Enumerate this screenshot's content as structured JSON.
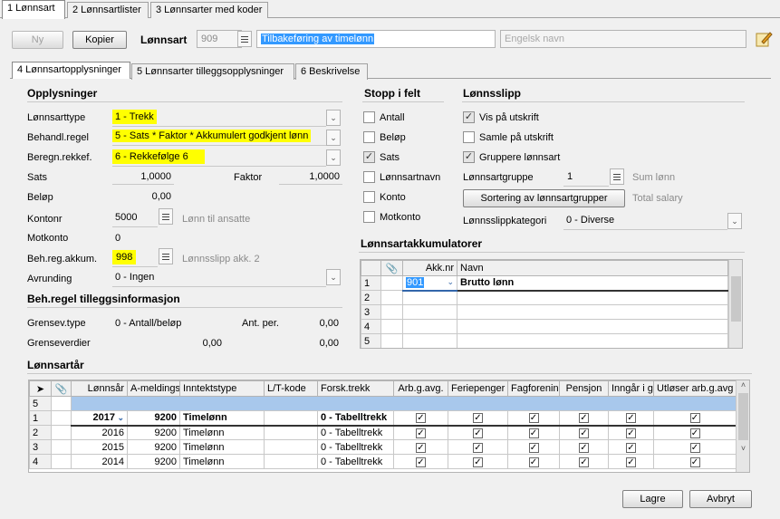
{
  "top_tabs": [
    "1 Lønnsart",
    "2 Lønnsartlister",
    "3 Lønnsarter med koder"
  ],
  "toolbar": {
    "new_label": "Ny",
    "copy_label": "Kopier",
    "lonnsart_label": "Lønnsart",
    "lonnsart_number": "909",
    "lonnsart_name": "Tilbakeføring av timelønn",
    "english_placeholder": "Engelsk navn"
  },
  "sub_tabs": [
    "4 Lønnsartopplysninger",
    "5 Lønnsarter tilleggsopplysninger",
    "6 Beskrivelse"
  ],
  "opplysninger": {
    "title": "Opplysninger",
    "lonnsarttype_label": "Lønnsarttype",
    "lonnsarttype_value": "1 - Trekk",
    "behandl_label": "Behandl.regel",
    "behandl_value": "5 - Sats * Faktor * Akkumulert godkjent lønn",
    "beregn_label": "Beregn.rekkef.",
    "beregn_value": "6 - Rekkefølge 6",
    "sats_label": "Sats",
    "sats_value": "1,0000",
    "faktor_label": "Faktor",
    "faktor_value": "1,0000",
    "belop_label": "Beløp",
    "belop_value": "0,00",
    "kontonr_label": "Kontonr",
    "kontonr_value": "5000",
    "kontonr_desc": "Lønn til ansatte",
    "motkonto_label": "Motkonto",
    "motkonto_value": "0",
    "behreg_label": "Beh.reg.akkum.",
    "behreg_value": "998",
    "behreg_desc": "Lønnsslipp akk. 2",
    "avrunding_label": "Avrunding",
    "avrunding_value": "0 - Ingen"
  },
  "tillegg": {
    "title": "Beh.regel tilleggsinformasjon",
    "grensev_type_label": "Grensev.type",
    "grensev_type_value": "0 - Antall/beløp",
    "ant_per_label": "Ant. per.",
    "ant_per_value": "0,00",
    "grenseverdier_label": "Grenseverdier",
    "grenseverdier_value1": "0,00",
    "grenseverdier_value2": "0,00"
  },
  "stopp": {
    "title": "Stopp i felt",
    "items": [
      {
        "label": "Antall",
        "checked": false
      },
      {
        "label": "Beløp",
        "checked": false
      },
      {
        "label": "Sats",
        "checked": true
      },
      {
        "label": "Lønnsartnavn",
        "checked": false
      },
      {
        "label": "Konto",
        "checked": false
      },
      {
        "label": "Motkonto",
        "checked": false
      }
    ]
  },
  "lonnsslipp": {
    "title": "Lønnsslipp",
    "vis": "Vis på utskrift",
    "samle": "Samle på utskrift",
    "gruppere": "Gruppere lønnsart",
    "gruppe_label": "Lønnsartgruppe",
    "gruppe_value": "1",
    "gruppe_desc": "Sum lønn",
    "sortering_button": "Sortering av lønnsartgrupper",
    "sortering_desc": "Total salary",
    "kategori_label": "Lønnsslippkategori",
    "kategori_value": "0 - Diverse"
  },
  "akkumulatorer": {
    "title": "Lønnsartakkumulatorer",
    "columns": [
      "Akk.nr",
      "Navn"
    ],
    "rows": [
      {
        "num": "1",
        "akknr": "901",
        "navn": "Brutto lønn"
      },
      {
        "num": "2",
        "akknr": "",
        "navn": ""
      },
      {
        "num": "3",
        "akknr": "",
        "navn": ""
      },
      {
        "num": "4",
        "akknr": "",
        "navn": ""
      },
      {
        "num": "5",
        "akknr": "",
        "navn": ""
      }
    ]
  },
  "lonnsarar": {
    "title": "Lønnsartår",
    "columns": [
      "Lønnsår",
      "A-meldings",
      "Inntektstype",
      "L/T-kode",
      "Forsk.trekk",
      "Arb.g.avg.",
      "Feriepenger",
      "Fagforening",
      "Pensjon",
      "Inngår i gr",
      "Utløser arb.g.avg"
    ],
    "new_row_num": "5",
    "rows": [
      {
        "num": "1",
        "year": "2017",
        "amelding": "9200",
        "type": "Timelønn",
        "lt": "",
        "forsk": "0 - Tabelltrekk"
      },
      {
        "num": "2",
        "year": "2016",
        "amelding": "9200",
        "type": "Timelønn",
        "lt": "",
        "forsk": "0 - Tabelltrekk"
      },
      {
        "num": "3",
        "year": "2015",
        "amelding": "9200",
        "type": "Timelønn",
        "lt": "",
        "forsk": "0 - Tabelltrekk"
      },
      {
        "num": "4",
        "year": "2014",
        "amelding": "9200",
        "type": "Timelønn",
        "lt": "",
        "forsk": "0 - Tabelltrekk"
      }
    ]
  },
  "footer": {
    "save_label": "Lagre",
    "cancel_label": "Avbryt"
  }
}
